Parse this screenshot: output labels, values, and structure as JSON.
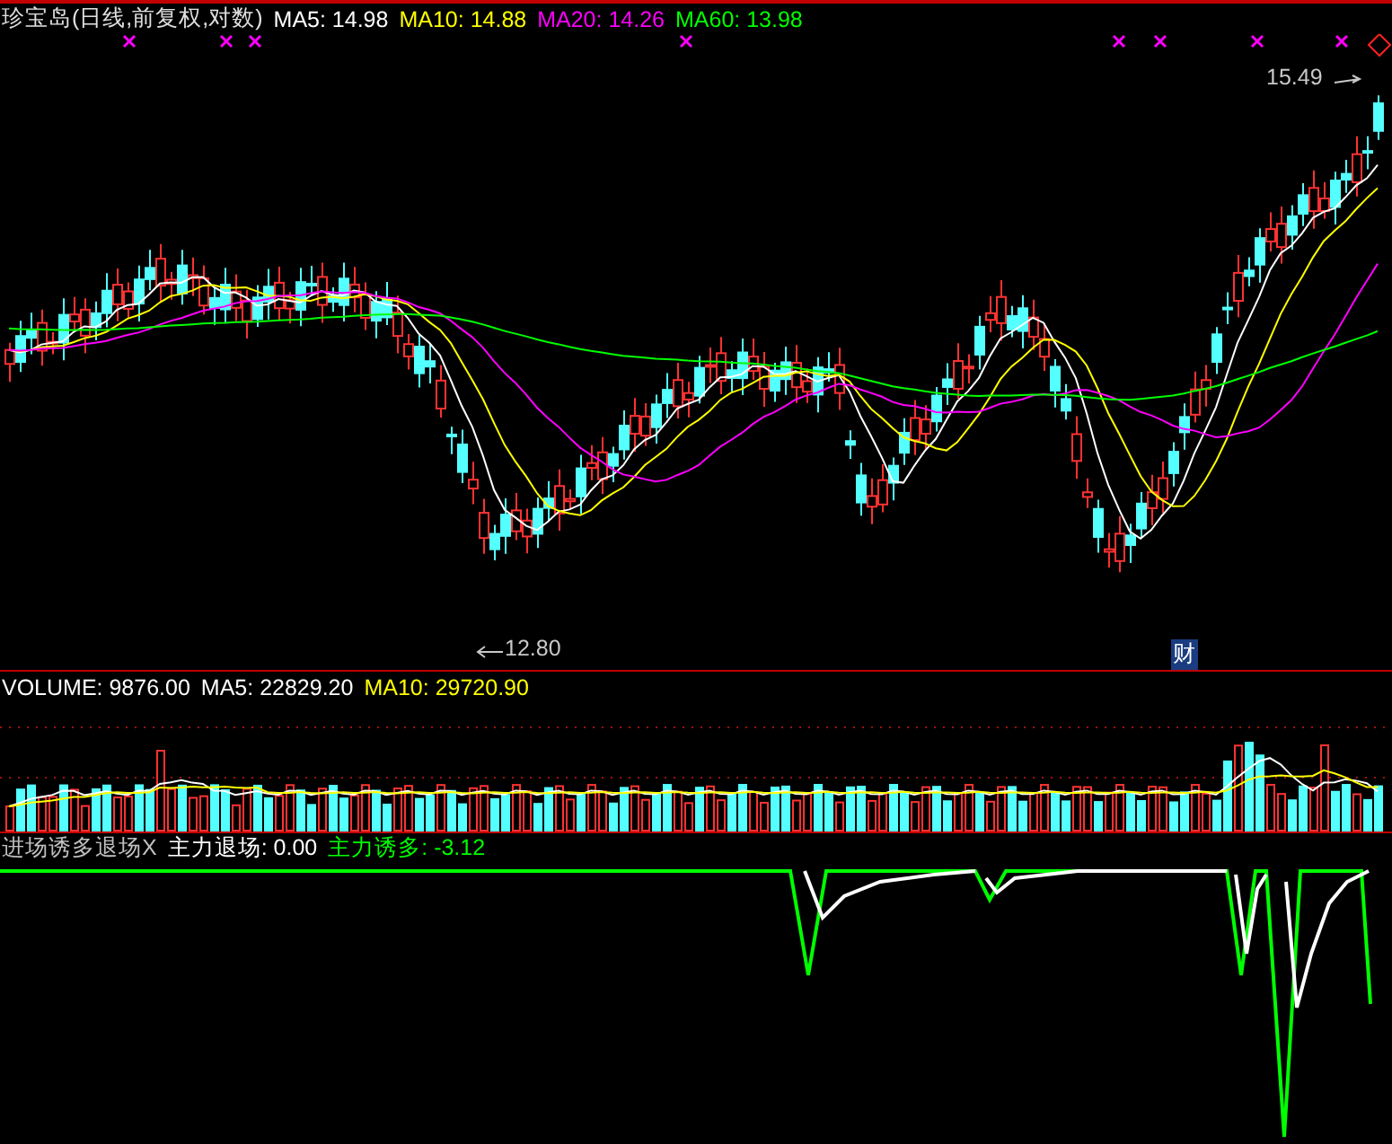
{
  "price_panel": {
    "title": "珍宝岛(日线,前复权,对数)",
    "indicators": [
      {
        "label": "MA5: 14.98",
        "color": "#ffffff"
      },
      {
        "label": "MA10: 14.88",
        "color": "#ffff00"
      },
      {
        "label": "MA20: 14.26",
        "color": "#ff00ff"
      },
      {
        "label": "MA60: 13.98",
        "color": "#00ff00"
      }
    ],
    "high_label": "15.49",
    "low_label": "12.80",
    "event_badge": "财"
  },
  "volume_panel": {
    "indicators": [
      {
        "label": "VOLUME: 9876.00",
        "color": "#ffffff"
      },
      {
        "label": "MA5: 22829.20",
        "color": "#ffffff"
      },
      {
        "label": "MA10: 29720.90",
        "color": "#ffff00"
      }
    ]
  },
  "indicator_panel": {
    "indicators": [
      {
        "label": "进场诱多退场X",
        "color": "#c0c0c0"
      },
      {
        "label": "主力退场: 0.00",
        "color": "#ffffff"
      },
      {
        "label": "主力诱多: -3.12",
        "color": "#00ff00"
      }
    ]
  }
}
